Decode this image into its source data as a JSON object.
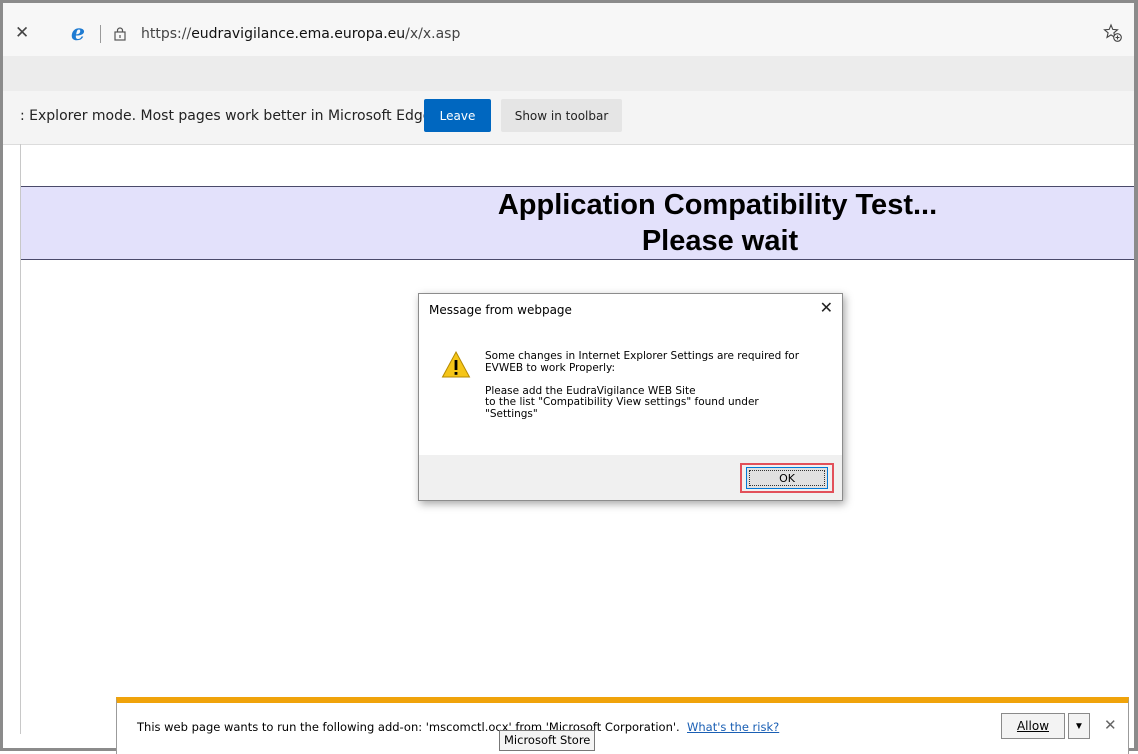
{
  "browser": {
    "url_prefix": "https://",
    "url_domain": "eudravigilance.ema.europa.eu",
    "url_path": "/x/x.asp",
    "close_glyph": "✕",
    "ie_icon_glyph": "e"
  },
  "ie_mode_bar": {
    "message": ": Explorer mode. Most pages work better in Microsoft Edge.",
    "leave_label": "Leave",
    "toolbar_label": "Show in toolbar"
  },
  "page": {
    "title": "Application Compatibility Test...",
    "subtitle": "Please wait",
    "banner_color": "#e3e1fb"
  },
  "dialog": {
    "title": "Message from webpage",
    "close_glyph": "✕",
    "message": "Some changes in Internet Explorer Settings are required for\nEVWEB to work Properly:\n\nPlease add the EudraVigilance WEB Site\nto the list \"Compatibility View settings\" found under\n\"Settings\"",
    "ok_label": "OK",
    "highlight_color": "#e2505a"
  },
  "notification": {
    "message": "This web page wants to run the following add-on: 'mscomctl.ocx' from 'Microsoft Corporation'.",
    "risk_link": "What's the risk?",
    "allow_label": "Allow",
    "dropdown_glyph": "▼",
    "close_glyph": "✕",
    "accent_color": "#f0a30a"
  },
  "tooltip": {
    "text": "Microsoft Store"
  }
}
